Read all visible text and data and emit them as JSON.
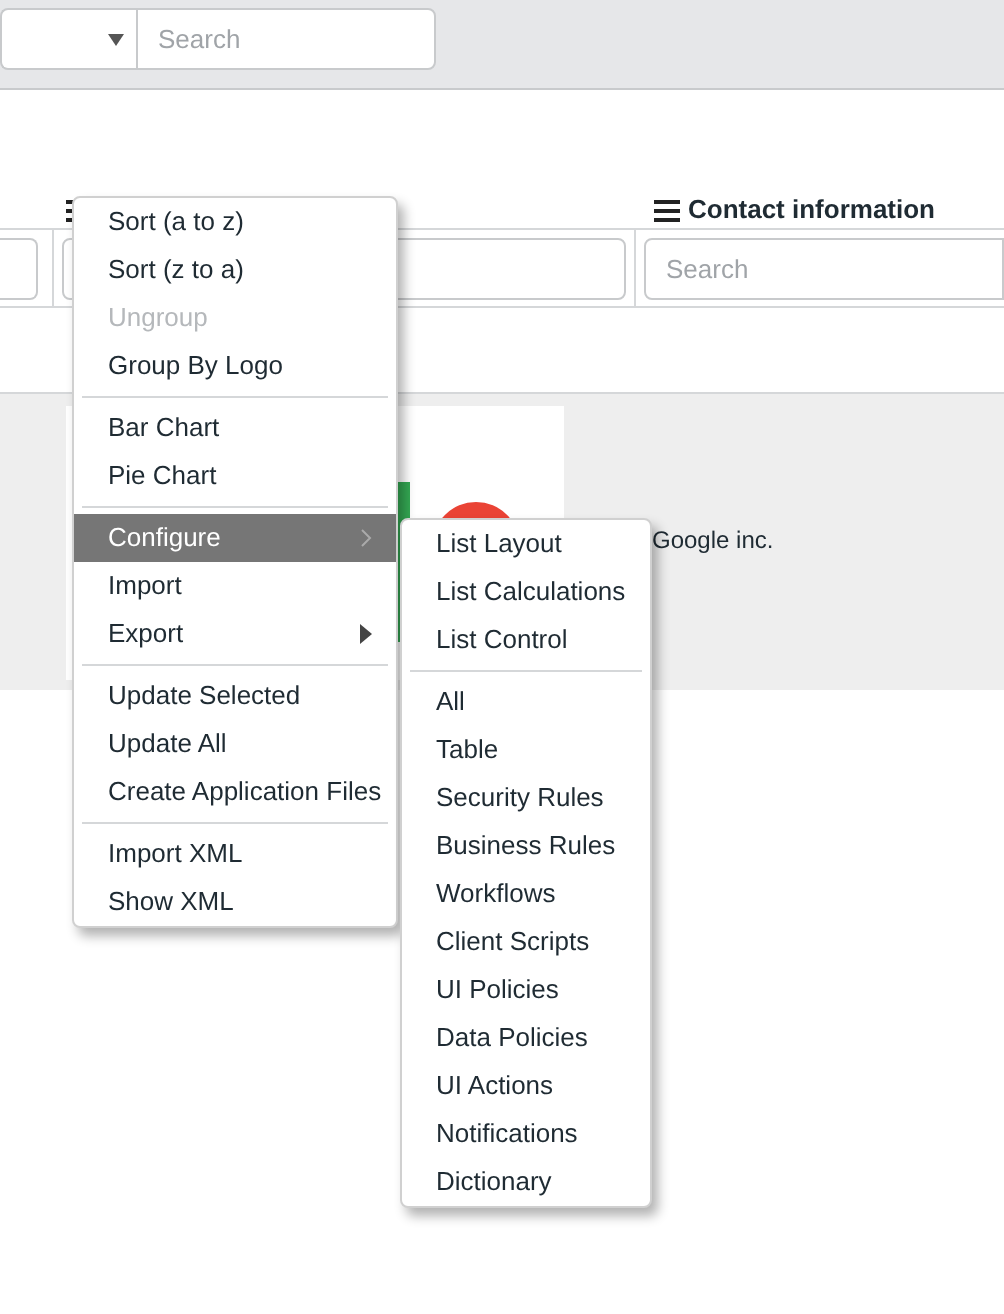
{
  "toolbar": {
    "search": {
      "placeholder": "Search"
    }
  },
  "columns": [
    {
      "title": "Contact information",
      "filter_placeholder": "Search"
    }
  ],
  "row": {
    "contact": "Google inc."
  },
  "context_menu": {
    "sections": [
      [
        {
          "label": "Sort (a to z)",
          "disabled": false,
          "selected": false,
          "kind": "action"
        },
        {
          "label": "Sort (z to a)",
          "disabled": false,
          "selected": false,
          "kind": "action"
        },
        {
          "label": "Ungroup",
          "disabled": true,
          "selected": false,
          "kind": "action"
        },
        {
          "label": "Group By Logo",
          "disabled": false,
          "selected": false,
          "kind": "action"
        }
      ],
      [
        {
          "label": "Bar Chart",
          "disabled": false,
          "selected": false,
          "kind": "action"
        },
        {
          "label": "Pie Chart",
          "disabled": false,
          "selected": false,
          "kind": "action"
        }
      ],
      [
        {
          "label": "Configure",
          "disabled": false,
          "selected": true,
          "kind": "submenu"
        },
        {
          "label": "Import",
          "disabled": false,
          "selected": false,
          "kind": "action"
        },
        {
          "label": "Export",
          "disabled": false,
          "selected": false,
          "kind": "submenu"
        }
      ],
      [
        {
          "label": "Update Selected",
          "disabled": false,
          "selected": false,
          "kind": "action"
        },
        {
          "label": "Update All",
          "disabled": false,
          "selected": false,
          "kind": "action"
        },
        {
          "label": "Create Application Files",
          "disabled": false,
          "selected": false,
          "kind": "action"
        }
      ],
      [
        {
          "label": "Import XML",
          "disabled": false,
          "selected": false,
          "kind": "action"
        },
        {
          "label": "Show XML",
          "disabled": false,
          "selected": false,
          "kind": "action"
        }
      ]
    ]
  },
  "submenu": {
    "sections": [
      [
        "List Layout",
        "List Calculations",
        "List Control"
      ],
      [
        "All",
        "Table",
        "Security Rules",
        "Business Rules",
        "Workflows",
        "Client Scripts",
        "UI Policies",
        "Data Policies",
        "UI Actions",
        "Notifications",
        "Dictionary"
      ]
    ]
  }
}
